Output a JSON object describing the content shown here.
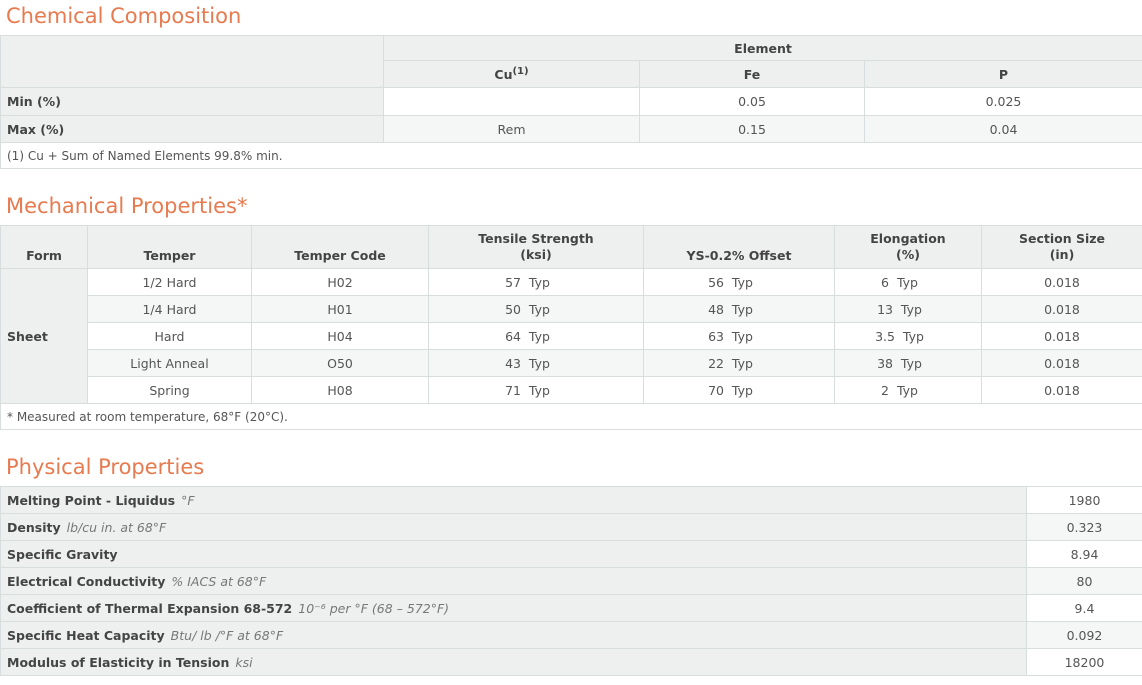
{
  "chemical": {
    "title": "Chemical Composition",
    "element_header": "Element",
    "columns": [
      "Cu",
      "Fe",
      "P"
    ],
    "cu_footnote_mark": "(1)",
    "rows": [
      {
        "label": "Min (%)",
        "values": [
          "",
          "0.05",
          "0.025"
        ]
      },
      {
        "label": "Max (%)",
        "values": [
          "Rem",
          "0.15",
          "0.04"
        ]
      }
    ],
    "note": "(1) Cu + Sum of Named Elements 99.8% min."
  },
  "mechanical": {
    "title": "Mechanical Properties*",
    "headers": {
      "form": "Form",
      "temper": "Temper",
      "temper_code": "Temper Code",
      "tensile": "Tensile Strength",
      "tensile_unit": "(ksi)",
      "ys": "YS-0.2% Offset",
      "elongation": "Elongation",
      "elongation_unit": "(%)",
      "section": "Section Size",
      "section_unit": "(in)"
    },
    "form": "Sheet",
    "typ": "Typ",
    "rows": [
      {
        "temper": "1/2 Hard",
        "code": "H02",
        "tensile": "57",
        "ys": "56",
        "elong": "6",
        "section": "0.018"
      },
      {
        "temper": "1/4 Hard",
        "code": "H01",
        "tensile": "50",
        "ys": "48",
        "elong": "13",
        "section": "0.018"
      },
      {
        "temper": "Hard",
        "code": "H04",
        "tensile": "64",
        "ys": "63",
        "elong": "3.5",
        "section": "0.018"
      },
      {
        "temper": "Light Anneal",
        "code": "O50",
        "tensile": "43",
        "ys": "22",
        "elong": "38",
        "section": "0.018"
      },
      {
        "temper": "Spring",
        "code": "H08",
        "tensile": "71",
        "ys": "70",
        "elong": "2",
        "section": "0.018"
      }
    ],
    "note": "* Measured at room temperature, 68°F (20°C)."
  },
  "physical": {
    "title": "Physical Properties",
    "rows": [
      {
        "label": "Melting Point - Liquidus",
        "unit": "°F",
        "value": "1980"
      },
      {
        "label": "Density",
        "unit": "lb/cu in. at 68°F",
        "value": "0.323"
      },
      {
        "label": "Specific Gravity",
        "unit": "",
        "value": "8.94"
      },
      {
        "label": "Electrical Conductivity",
        "unit": "% IACS at 68°F",
        "value": "80"
      },
      {
        "label": "Coefficient of Thermal Expansion 68-572",
        "unit": "10⁻⁶ per °F (68 – 572°F)",
        "value": "9.4"
      },
      {
        "label": "Specific Heat Capacity",
        "unit": "Btu/ lb /°F at 68°F",
        "value": "0.092"
      },
      {
        "label": "Modulus of Elasticity in Tension",
        "unit": "ksi",
        "value": "18200"
      }
    ]
  }
}
